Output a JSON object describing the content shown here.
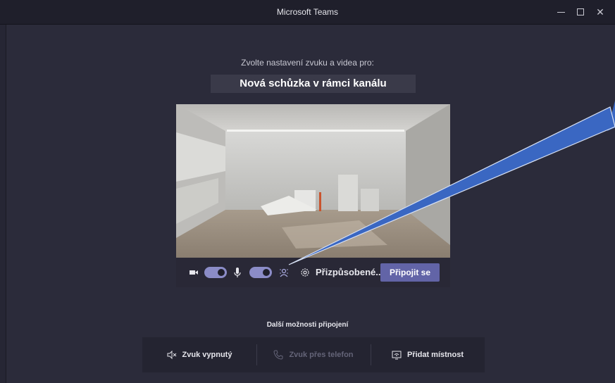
{
  "window": {
    "title": "Microsoft Teams",
    "minimize_icon": "minimize-icon",
    "maximize_icon": "maximize-icon",
    "close_icon": "close-icon",
    "close_glyph": "✕"
  },
  "prejoin": {
    "prompt": "Zvolte nastavení zvuku a videa pro:",
    "meeting_title": "Nová schůzka v rámci kanálu"
  },
  "controls": {
    "camera_icon": "video-camera-icon",
    "camera_on": true,
    "mic_icon": "microphone-icon",
    "mic_on": true,
    "background_icon": "background-blur-icon",
    "settings_icon": "gear-icon",
    "device_label": "Přizpůsobené...",
    "join_label": "Připojit se"
  },
  "more": {
    "heading": "Další možnosti připojení",
    "options": [
      {
        "label": "Zvuk vypnutý",
        "icon": "speaker-muted-icon",
        "enabled": true
      },
      {
        "label": "Zvuk přes telefon",
        "icon": "phone-icon",
        "enabled": false
      },
      {
        "label": "Přidat místnost",
        "icon": "room-display-icon",
        "enabled": true
      }
    ]
  },
  "colors": {
    "background": "#2b2b3a",
    "accent": "#6264a7",
    "toggle_on": "#8b8cc7",
    "annotation_arrow": "#3a67c2"
  }
}
